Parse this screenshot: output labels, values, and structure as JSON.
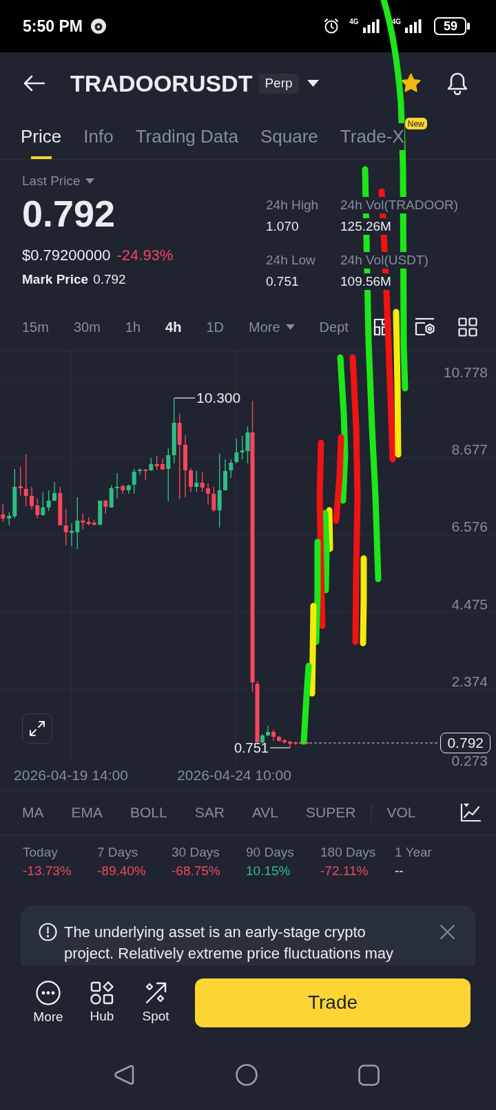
{
  "status_bar": {
    "time": "5:50 PM",
    "networks": [
      {
        "label": "4G"
      },
      {
        "label": "4G"
      }
    ],
    "battery": "59"
  },
  "header": {
    "title": "TRADOORUSDT",
    "badge": "Perp",
    "favorite": true
  },
  "tabs": [
    {
      "label": "Price",
      "selected": true
    },
    {
      "label": "Info",
      "selected": false
    },
    {
      "label": "Trading Data",
      "selected": false
    },
    {
      "label": "Square",
      "selected": false
    },
    {
      "label": "Trade-X",
      "selected": false,
      "badge": "New"
    }
  ],
  "price": {
    "label": "Last Price",
    "value": "0.792",
    "usd_value": "$0.79200000",
    "change": "-24.93%",
    "negative": true,
    "mark_label": "Mark Price",
    "mark_value": "0.792"
  },
  "stats": [
    {
      "label": "24h High",
      "value": "1.070"
    },
    {
      "label": "24h Vol(TRADOOR)",
      "value": "125.26M"
    },
    {
      "label": "24h Low",
      "value": "0.751"
    },
    {
      "label": "24h Vol(USDT)",
      "value": "109.56M"
    }
  ],
  "intervals": [
    {
      "label": "15m",
      "kind": "interval",
      "selected": false
    },
    {
      "label": "30m",
      "kind": "interval",
      "selected": false
    },
    {
      "label": "1h",
      "kind": "interval",
      "selected": false
    },
    {
      "label": "4h",
      "kind": "interval",
      "selected": true
    },
    {
      "label": "1D",
      "kind": "interval",
      "selected": false
    },
    {
      "label": "More",
      "kind": "menu",
      "selected": false
    },
    {
      "label": "Dept",
      "kind": "view",
      "selected": false
    }
  ],
  "chart": {
    "y_axis": [
      "10.778",
      "8.677",
      "6.576",
      "4.475",
      "2.374",
      "0.273"
    ],
    "x_axis": [
      "2026-04-19 14:00",
      "2026-04-24 10:00"
    ],
    "high_marker": "10.300",
    "low_marker": "0.751",
    "price_tag": "0.792"
  },
  "indicators": {
    "main": [
      "MA",
      "EMA",
      "BOLL",
      "SAR",
      "AVL",
      "SUPER"
    ],
    "sub": [
      "VOL"
    ]
  },
  "performance": [
    {
      "label": "Today",
      "value": "-13.73%",
      "color": "#f6465d"
    },
    {
      "label": "7 Days",
      "value": "-89.40%",
      "color": "#f6465d"
    },
    {
      "label": "30 Days",
      "value": "-68.75%",
      "color": "#f6465d"
    },
    {
      "label": "90 Days",
      "value": "10.15%",
      "color": "#2ebd85"
    },
    {
      "label": "180 Days",
      "value": "-72.11%",
      "color": "#f6465d"
    },
    {
      "label": "1 Year",
      "value": "--",
      "color": "#eaecef"
    }
  ],
  "notice": {
    "text": "The underlying asset is an early-stage crypto project. Relatively extreme price fluctuations may"
  },
  "actions": [
    {
      "label": "More"
    },
    {
      "label": "Hub"
    },
    {
      "label": "Spot"
    }
  ],
  "trade_button": {
    "label": "Trade"
  }
}
